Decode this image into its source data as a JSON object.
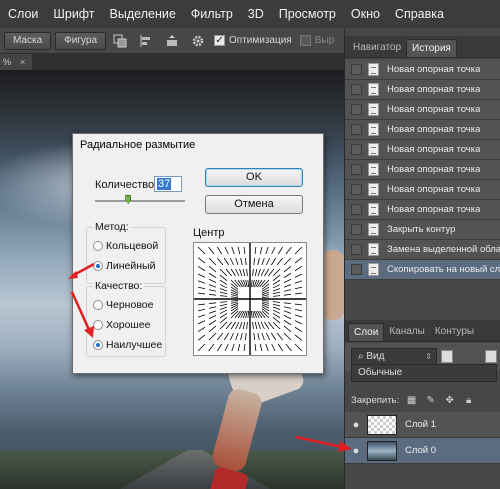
{
  "menu": [
    "Слои",
    "Шрифт",
    "Выделение",
    "Фильтр",
    "3D",
    "Просмотр",
    "Окно",
    "Справка"
  ],
  "options_bar": {
    "mask_label": "Маска",
    "shape_label": "Фигура",
    "optimize_label": "Оптимизация",
    "cut_label": "Выр"
  },
  "document": {
    "tab_label": "%",
    "tab_close": "×"
  },
  "history_panel": {
    "tabs": [
      "Навигатор",
      "История"
    ],
    "active_tab": "История",
    "items": [
      "Новая опорная точка",
      "Новая опорная точка",
      "Новая опорная точка",
      "Новая опорная точка",
      "Новая опорная точка",
      "Новая опорная точка",
      "Новая опорная точка",
      "Новая опорная точка",
      "Закрыть контур",
      "Замена выделенной обла",
      "Скопировать на новый сл"
    ],
    "selected_index": 10
  },
  "layers_panel": {
    "tabs": [
      "Слои",
      "Каналы",
      "Контуры"
    ],
    "active_tab": "Слои",
    "kind_filter": "Вид",
    "blend_mode": "Обычные",
    "lock_label": "Закрепить:",
    "layers": [
      {
        "name": "Слой 1",
        "thumb": "transparent",
        "selected": false
      },
      {
        "name": "Слой 0",
        "thumb": "image",
        "selected": true
      }
    ]
  },
  "dialog": {
    "title": "Радиальное размытие",
    "amount_label": "Количество",
    "amount_value": "37",
    "amount_slider_fraction": 0.37,
    "ok_label": "OK",
    "cancel_label": "Отмена",
    "method_label": "Метод:",
    "method_options": [
      "Кольцевой",
      "Линейный"
    ],
    "method_selected": "Линейный",
    "quality_label": "Качество:",
    "quality_options": [
      "Черновое",
      "Хорошее",
      "Наилучшее"
    ],
    "quality_selected": "Наилучшее",
    "center_label": "Центр"
  },
  "colors": {
    "selection_highlight": "#5b6b80",
    "annotation_arrow": "#e02020"
  }
}
